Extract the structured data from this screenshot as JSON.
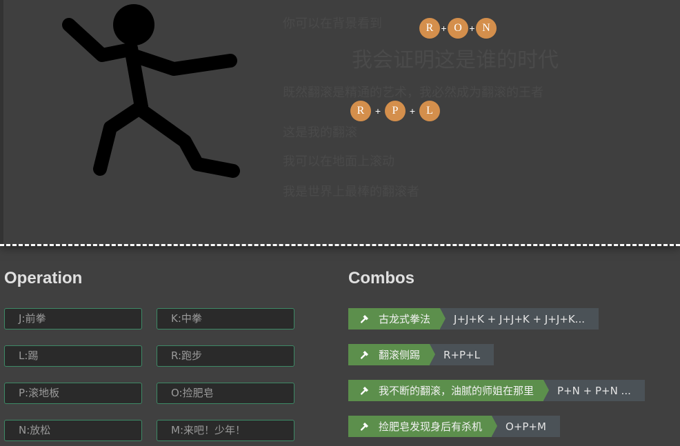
{
  "stage": {
    "lines": [
      "你可以在背景看到",
      "我会证明这是谁的时代",
      "既然翻滚是精通的艺术，我必然成为翻滚的王者",
      "这是我的翻滚",
      "我可以在地面上滚动",
      "我是世界上最棒的翻滚者"
    ],
    "combo_hints": [
      {
        "keys": [
          "R",
          "O",
          "N"
        ]
      },
      {
        "keys": [
          "R",
          "P",
          "L"
        ]
      }
    ],
    "plus_symbol": "+"
  },
  "operation": {
    "title": "Operation",
    "keys": [
      "J:前拳",
      "K:中拳",
      "L:踢",
      "R:跑步",
      "P:滚地板",
      "O:捡肥皂",
      "N:放松",
      "M:来吧！少年！"
    ]
  },
  "combos": {
    "title": "Combos",
    "items": [
      {
        "name": "古龙式拳法",
        "keys": "J+J+K + J+J+K + J+J+K...",
        "icon": "hammer-icon"
      },
      {
        "name": "翻滚侧踢",
        "keys": "R+P+L",
        "icon": "hammer-icon"
      },
      {
        "name": "我不断的翻滚，油腻的师姐在那里",
        "keys": "P+N + P+N ...",
        "icon": "hammer-icon"
      },
      {
        "name": "捡肥皂发现身后有杀机",
        "keys": "O+P+M",
        "icon": "hammer-icon"
      }
    ]
  },
  "colors": {
    "page_background": "#404040",
    "key_ball": "#d48f4c",
    "combo_name_bg": "#5c8f4c",
    "combo_keys_bg": "#4b5257",
    "operation_border": "#3d8a66"
  }
}
